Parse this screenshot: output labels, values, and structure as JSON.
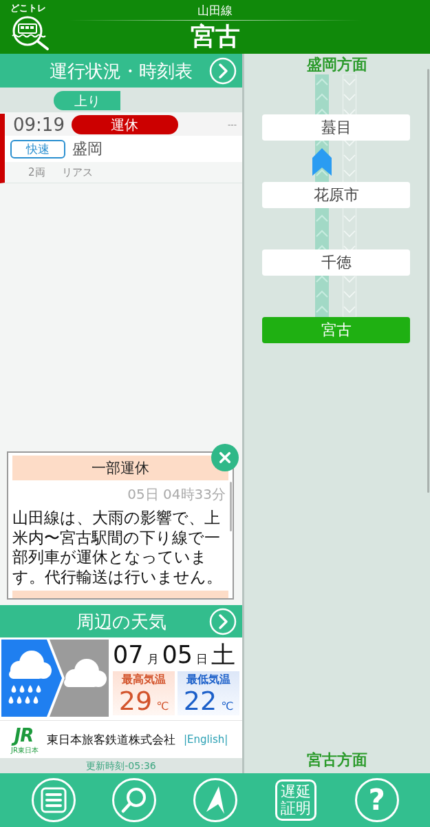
{
  "header": {
    "logo_text": "どこトレ",
    "line": "山田線",
    "station": "宮古"
  },
  "timetable": {
    "title": "運行状況・時刻表",
    "tabs": [
      {
        "label": "上り",
        "selected": true
      }
    ],
    "trains": [
      {
        "time": "09:19",
        "status": "運休",
        "kind": "suspended",
        "note": "---",
        "type": "快速",
        "destination": "盛岡",
        "cars": "2両",
        "name": "リアス"
      }
    ]
  },
  "notices": [
    {
      "title": "一部運休",
      "time": "05日 04時33分",
      "body": "山田線は、大雨の影響で、上米内〜宮古駅間の下り線で一部列車が運休となっています。代行輸送は行いません。"
    }
  ],
  "weather": {
    "title": "周辺の天気",
    "forecast": [
      {
        "kind": "rain"
      },
      {
        "kind": "cloudy"
      }
    ],
    "month": "07",
    "month_unit": "月",
    "day": "05",
    "day_unit": "日",
    "weekday": "土",
    "temperatures": [
      {
        "kind": "high",
        "label": "最高気温",
        "value": "29",
        "unit": "℃"
      },
      {
        "kind": "low",
        "label": "最低気温",
        "value": "22",
        "unit": "℃"
      }
    ]
  },
  "company": {
    "logo": "JR",
    "logo_caption": "JR東日本",
    "name": "東日本旅客鉄道株式会社",
    "link": "|English|"
  },
  "updated": "更新時刻-05:36",
  "route_map": {
    "top_direction": "盛岡方面",
    "stations": [
      {
        "name": "蟇目",
        "current": false,
        "train_below": true
      },
      {
        "name": "花原市",
        "current": false,
        "train_below": false
      },
      {
        "name": "千徳",
        "current": false,
        "train_below": false
      },
      {
        "name": "宮古",
        "current": true,
        "train_below": false
      }
    ],
    "bottom_direction": "宮古方面"
  },
  "nav": [
    {
      "kind": "menu"
    },
    {
      "kind": "search"
    },
    {
      "kind": "compass"
    },
    {
      "kind": "certificate",
      "label": "遅延証明"
    },
    {
      "kind": "help",
      "label": "?"
    }
  ]
}
